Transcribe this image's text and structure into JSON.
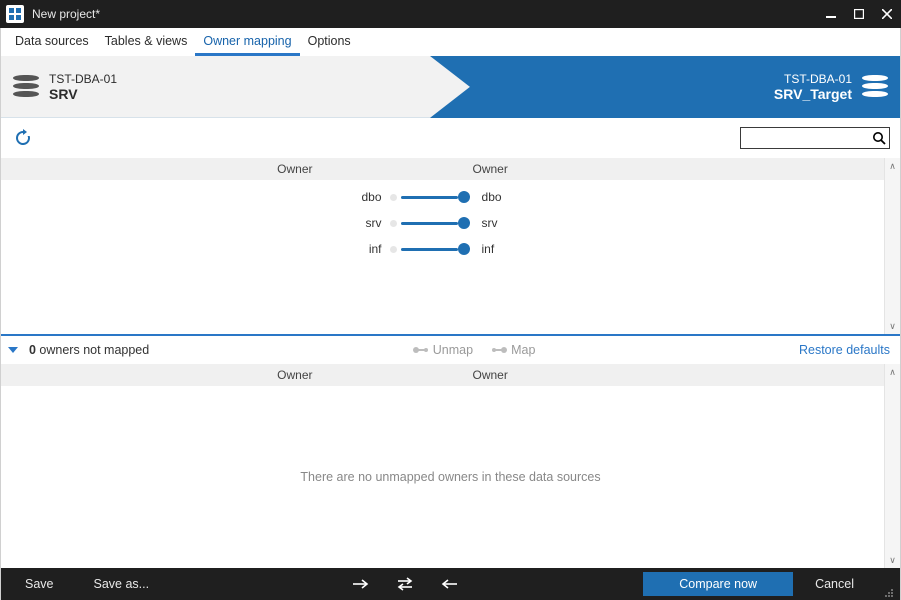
{
  "window": {
    "title": "New project*"
  },
  "tabs": {
    "data_sources": "Data sources",
    "tables_views": "Tables & views",
    "owner_mapping": "Owner mapping",
    "options": "Options",
    "active": "owner_mapping"
  },
  "source": {
    "server": "TST-DBA-01",
    "database": "SRV"
  },
  "target": {
    "server": "TST-DBA-01",
    "database": "SRV_Target"
  },
  "search": {
    "placeholder": ""
  },
  "headers": {
    "left": "Owner",
    "right": "Owner"
  },
  "mappings": [
    {
      "left": "dbo",
      "right": "dbo"
    },
    {
      "left": "srv",
      "right": "srv"
    },
    {
      "left": "inf",
      "right": "inf"
    }
  ],
  "unmapped": {
    "count": 0,
    "label_template": " owners not mapped",
    "unmap": "Unmap",
    "map": "Map",
    "restore": "Restore defaults",
    "header_left": "Owner",
    "header_right": "Owner",
    "empty_text": "There are no unmapped owners in these data sources"
  },
  "footer": {
    "save": "Save",
    "save_as": "Save as...",
    "compare_now": "Compare now",
    "cancel": "Cancel"
  }
}
